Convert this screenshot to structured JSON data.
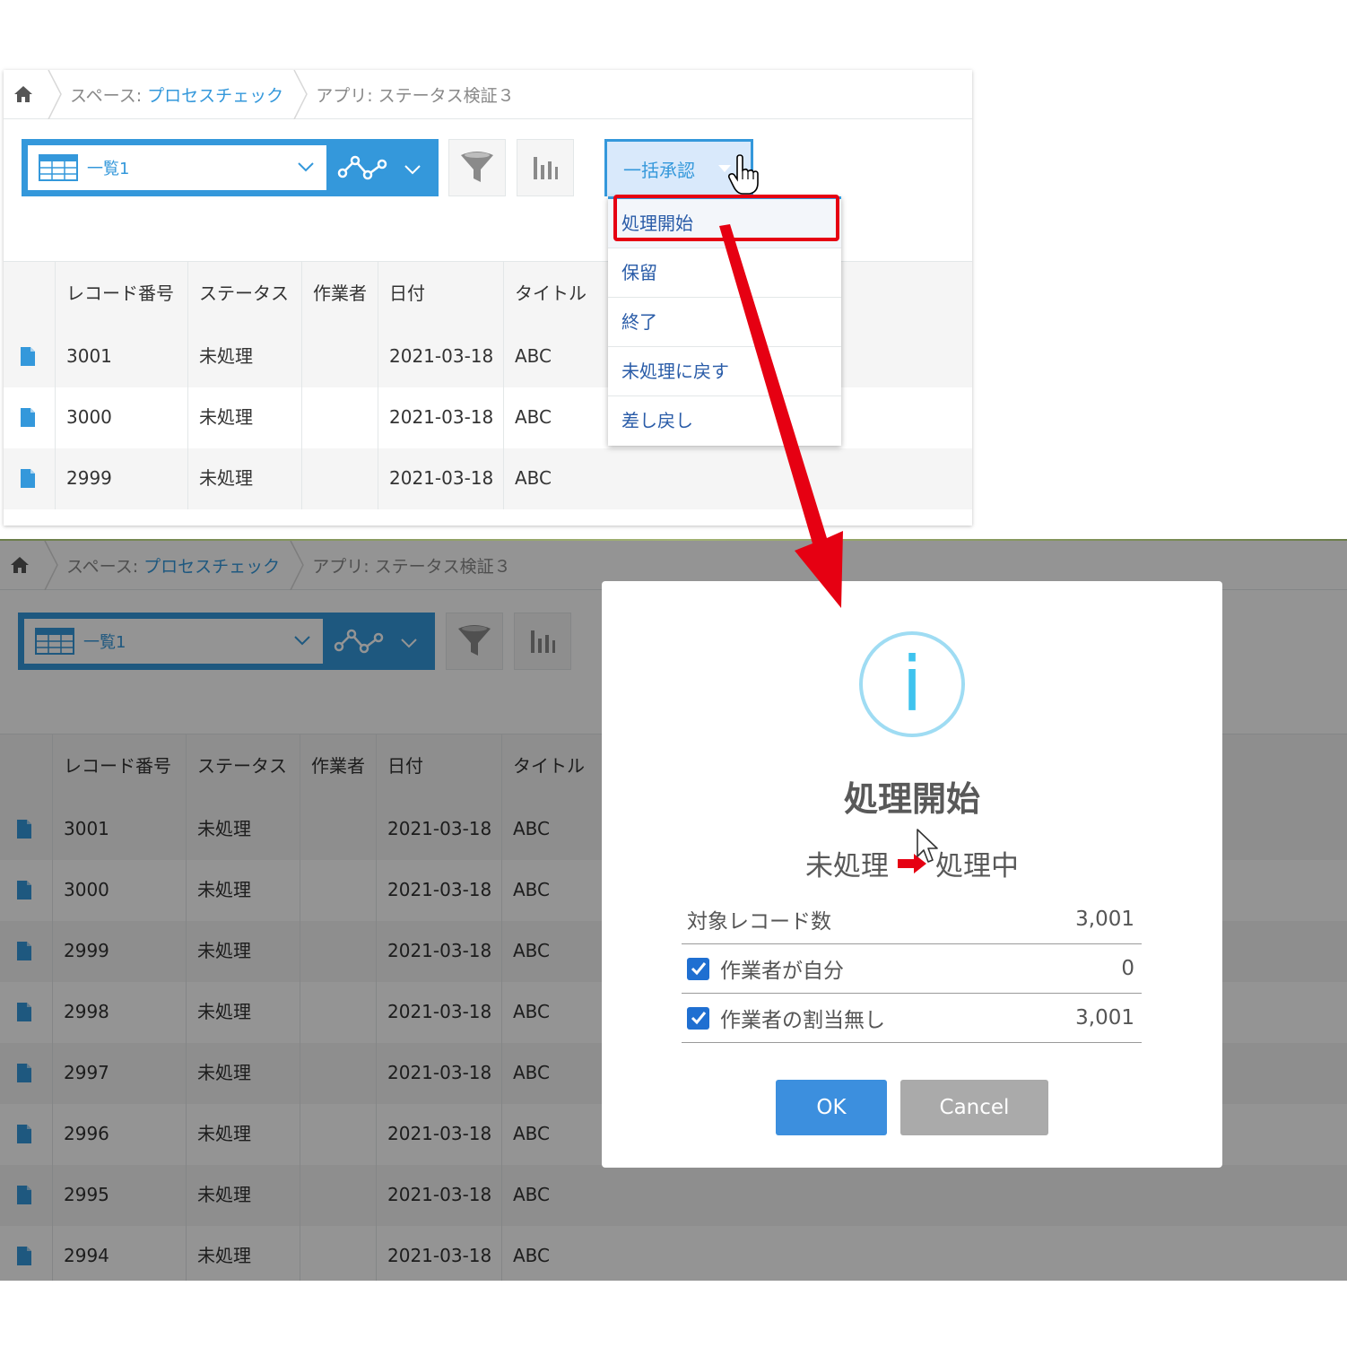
{
  "breadcrumb": {
    "space_prefix": "スペース: ",
    "space_name": "プロセスチェック",
    "app_label": "アプリ: ステータス検証３"
  },
  "view": {
    "name": "一覧1"
  },
  "bulk_approve": {
    "label": "一括承認"
  },
  "dropdown_items": [
    "処理開始",
    "保留",
    "終了",
    "未処理に戻す",
    "差し戻し"
  ],
  "table": {
    "headers": [
      "レコード番号",
      "ステータス",
      "作業者",
      "日付",
      "タイトル"
    ],
    "top_rows": [
      {
        "id": "3001",
        "status": "未処理",
        "assignee": "",
        "date": "2021-03-18",
        "title": "ABC"
      },
      {
        "id": "3000",
        "status": "未処理",
        "assignee": "",
        "date": "2021-03-18",
        "title": "ABC"
      },
      {
        "id": "2999",
        "status": "未処理",
        "assignee": "",
        "date": "2021-03-18",
        "title": "ABC"
      }
    ],
    "bottom_rows": [
      {
        "id": "3001",
        "status": "未処理",
        "assignee": "",
        "date": "2021-03-18",
        "title": "ABC"
      },
      {
        "id": "3000",
        "status": "未処理",
        "assignee": "",
        "date": "2021-03-18",
        "title": "ABC"
      },
      {
        "id": "2999",
        "status": "未処理",
        "assignee": "",
        "date": "2021-03-18",
        "title": "ABC"
      },
      {
        "id": "2998",
        "status": "未処理",
        "assignee": "",
        "date": "2021-03-18",
        "title": "ABC"
      },
      {
        "id": "2997",
        "status": "未処理",
        "assignee": "",
        "date": "2021-03-18",
        "title": "ABC"
      },
      {
        "id": "2996",
        "status": "未処理",
        "assignee": "",
        "date": "2021-03-18",
        "title": "ABC"
      },
      {
        "id": "2995",
        "status": "未処理",
        "assignee": "",
        "date": "2021-03-18",
        "title": "ABC"
      },
      {
        "id": "2994",
        "status": "未処理",
        "assignee": "",
        "date": "2021-03-18",
        "title": "ABC"
      }
    ]
  },
  "dialog": {
    "icon": "info-icon",
    "title": "処理開始",
    "from_status": "未処理",
    "to_status": "処理中",
    "rows": [
      {
        "label": "対象レコード数",
        "value": "3,001",
        "checkbox": false
      },
      {
        "label": "作業者が自分",
        "value": "0",
        "checkbox": true
      },
      {
        "label": "作業者の割当無し",
        "value": "3,001",
        "checkbox": true
      }
    ],
    "ok_label": "OK",
    "cancel_label": "Cancel"
  },
  "colors": {
    "accent": "#3498db",
    "highlight_red": "#e60012",
    "ok_button": "#3c8fde",
    "cancel_button": "#aaaaaa",
    "info_icon": "#3fc3ee"
  }
}
